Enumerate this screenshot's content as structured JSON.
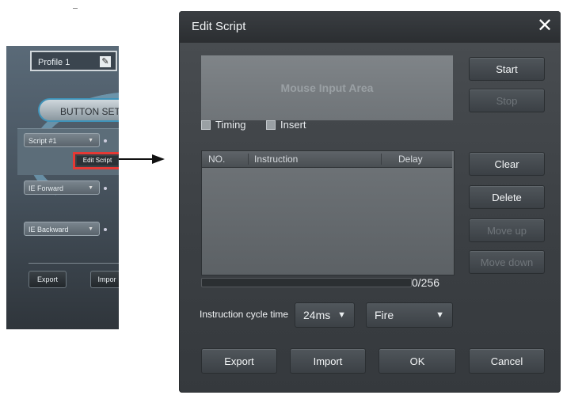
{
  "left_panel": {
    "profile": "Profile 1",
    "pencil_icon": "pencil-icon",
    "button_settings": "BUTTON SETTIN",
    "script_dropdown": "Script #1",
    "edit_script_mini": "Edit Script",
    "ie_forward": "IE Forward",
    "ie_backward": "IE Backward",
    "export": "Export",
    "import": "Impor"
  },
  "dialog": {
    "title": "Edit Script",
    "close_icon": "close-icon",
    "mouse_area": "Mouse Input Area",
    "checkboxes": {
      "timing": "Timing",
      "insert": "Insert"
    },
    "buttons": {
      "start": "Start",
      "stop": "Stop",
      "clear": "Clear",
      "delete": "Delete",
      "move_up": "Move up",
      "move_down": "Move down"
    },
    "table": {
      "col_no": "NO.",
      "col_instruction": "Instruction",
      "col_delay": "Delay"
    },
    "count": "0/256",
    "cycle_label": "Instruction cycle time",
    "cycle_value": "24ms",
    "fire_value": "Fire",
    "bottom_buttons": {
      "export": "Export",
      "import": "Import",
      "ok": "OK",
      "cancel": "Cancel"
    }
  },
  "colors": {
    "highlight_red": "#e53935",
    "dialog_bg": "#3b3f43"
  }
}
